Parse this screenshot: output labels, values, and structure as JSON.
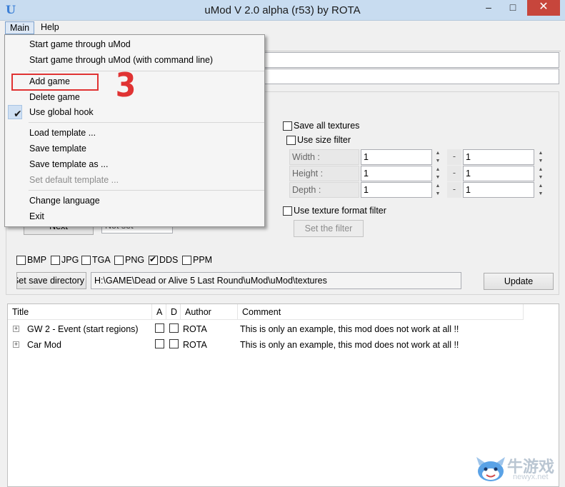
{
  "window": {
    "title": "uMod V 2.0 alpha (r53)  by  ROTA",
    "icon": "U"
  },
  "menubar": {
    "main_label": "Main",
    "help_label": "Help"
  },
  "main_menu": {
    "items": [
      {
        "label": "Start game through uMod"
      },
      {
        "label": "Start game through uMod (with command line)"
      },
      {
        "label": "Add game"
      },
      {
        "label": "Delete game"
      },
      {
        "label": "Use global hook",
        "checked": true
      },
      {
        "label": "Load template ..."
      },
      {
        "label": "Save template"
      },
      {
        "label": "Save template as ..."
      },
      {
        "label": "Set default template ...",
        "disabled": true
      },
      {
        "label": "Change language"
      },
      {
        "label": "Exit"
      }
    ]
  },
  "annotation": {
    "step_number": "3",
    "color": "#e03333"
  },
  "texture_options": {
    "save_all_textures": "Save all textures",
    "use_size_filter": "Use size filter",
    "width_label": "Width :",
    "height_label": "Height :",
    "depth_label": "Depth :",
    "width_min": "1",
    "width_max": "1",
    "height_min": "1",
    "height_max": "1",
    "depth_min": "1",
    "depth_max": "1",
    "range_separator": "-",
    "use_format_filter": "Use texture format filter",
    "set_filter_button": "Set the filter",
    "next_button": "Next",
    "not_set_text": "Not set"
  },
  "formats": [
    {
      "label": "BMP",
      "checked": false
    },
    {
      "label": "JPG",
      "checked": false
    },
    {
      "label": "TGA",
      "checked": false
    },
    {
      "label": "PNG",
      "checked": false
    },
    {
      "label": "DDS",
      "checked": true
    },
    {
      "label": "PPM",
      "checked": false
    }
  ],
  "save_directory": {
    "button_label": "Set save directory",
    "path": "H:\\GAME\\Dead or Alive 5 Last Round\\uMod\\uMod\\textures",
    "update_button": "Update"
  },
  "mod_table": {
    "columns": [
      "Title",
      "A",
      "D",
      "Author",
      "Comment"
    ],
    "rows": [
      {
        "title": "GW 2 - Event  (start regions)",
        "author": "ROTA",
        "comment": "This is only an example, this mod does not work at all !!"
      },
      {
        "title": "Car Mod",
        "author": "ROTA",
        "comment": "This is only an example, this mod does not work at all !!"
      }
    ]
  },
  "watermark": {
    "text": "牛游戏",
    "url": "newyx.net"
  }
}
